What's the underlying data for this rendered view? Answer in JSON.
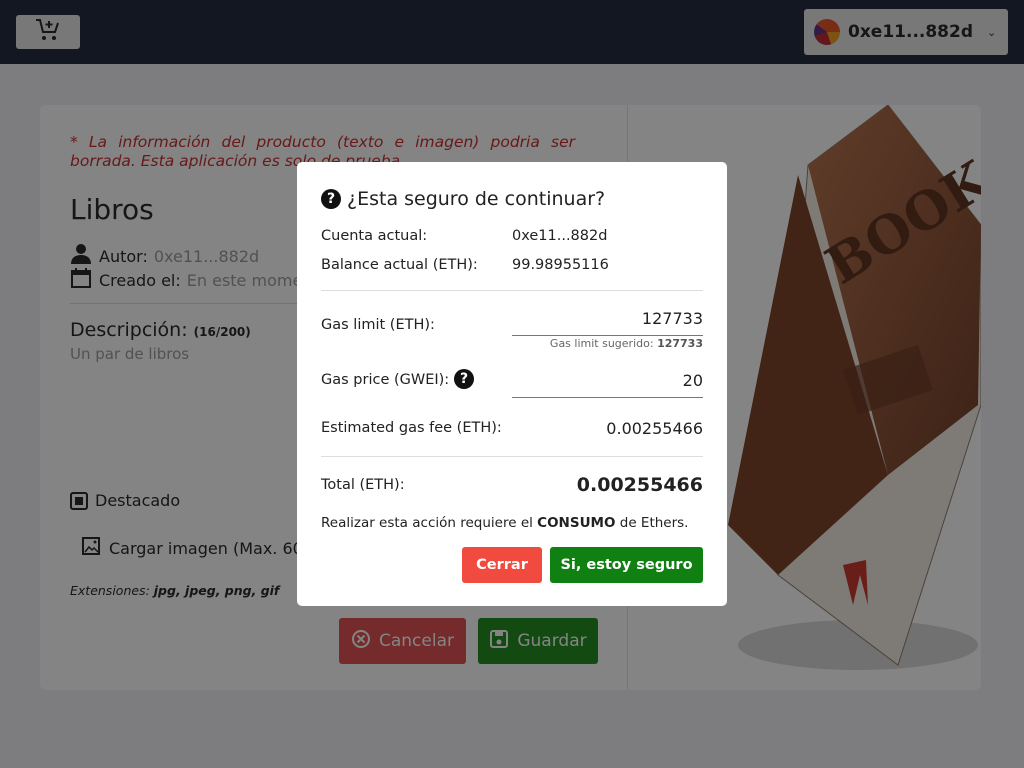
{
  "header": {
    "cart_icon": "cart-plus-icon",
    "account_label": "0xe11...882d",
    "account_icon": "avatar-icon"
  },
  "product": {
    "warning": "* La información del producto (texto e imagen) podria ser borrada. Esta aplicación es solo de prueba",
    "title": "Libros",
    "author_label": "Autor:",
    "author_value": "0xe11...882d",
    "created_label": "Creado el:",
    "created_value": "En este momento",
    "description_title": "Descripción:",
    "description_count": "(16/200)",
    "description_text": "Un par de libros",
    "featured_label": "Destacado",
    "upload_label": "Cargar imagen (Max. 60",
    "extensions_label": "Extensiones:",
    "extensions_value": "jpg, jpeg, png, gif",
    "cancel_label": "Cancelar",
    "save_label": "Guardar",
    "image_text": "BOOK"
  },
  "modal": {
    "title": "¿Esta seguro de continuar?",
    "account_label": "Cuenta actual:",
    "account_value": "0xe11...882d",
    "balance_label": "Balance actual (ETH):",
    "balance_value": "99.98955116",
    "gas_limit_label": "Gas limit (ETH):",
    "gas_limit_value": "127733",
    "gas_limit_hint": "Gas limit sugerido:",
    "gas_limit_hint_value": "127733",
    "gas_price_label": "Gas price (GWEI):",
    "gas_price_value": "20",
    "fee_label": "Estimated gas fee (ETH):",
    "fee_value": "0.00255466",
    "total_label": "Total (ETH):",
    "total_value": "0.00255466",
    "notice_pre": "Realizar esta acción requiere el",
    "notice_bold": "CONSUMO",
    "notice_post": "de Ethers.",
    "close_label": "Cerrar",
    "confirm_label": "Si, estoy seguro",
    "help_icon": "question-circle-icon"
  },
  "colors": {
    "header_bg": "#1c2438",
    "warning": "#c62828",
    "danger": "#f14a3f",
    "success": "#118013"
  }
}
